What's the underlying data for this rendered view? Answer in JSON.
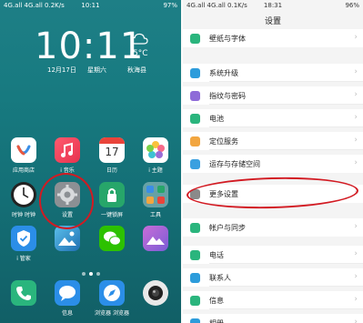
{
  "home": {
    "status": {
      "left": "4G.all 4G.all 0.2K/s",
      "time": "10:11",
      "right": "97%"
    },
    "clock": "10:11",
    "date": "12月17日",
    "weekday": "星期六",
    "temperature": "5°C",
    "city": "秋海县",
    "apps": [
      {
        "label": "应用商店"
      },
      {
        "label": "i 音乐"
      },
      {
        "label": "日历"
      },
      {
        "label": "i 主题"
      },
      {
        "label": "时钟 时钟"
      },
      {
        "label": "设置"
      },
      {
        "label": "一键锁屏"
      },
      {
        "label": "工具"
      },
      {
        "label": "i 管家"
      },
      {
        "label": ""
      },
      {
        "label": ""
      },
      {
        "label": ""
      }
    ],
    "calendar_day": "17",
    "dock": [
      {
        "label": ""
      },
      {
        "label": "信息"
      },
      {
        "label": "浏览器 浏览器"
      },
      {
        "label": ""
      }
    ]
  },
  "settings": {
    "status": {
      "left": "4G.all 4G.all 0.1K/s",
      "time": "18:31",
      "right": "96%"
    },
    "title": "设置",
    "rows": [
      {
        "label": "壁纸与字体",
        "color": "#2ab57d"
      },
      {
        "label": "系统升级",
        "color": "#2d9cdb"
      },
      {
        "label": "指纹与密码",
        "color": "#8e6bd8"
      },
      {
        "label": "电池",
        "color": "#2ab57d"
      },
      {
        "label": "定位服务",
        "color": "#f2a640"
      },
      {
        "label": "运存与存储空间",
        "color": "#3aa0e0"
      },
      {
        "label": "更多设置",
        "color": "#8a8a8a"
      },
      {
        "label": "帐户与同步",
        "color": "#2ab57d"
      },
      {
        "label": "电话",
        "color": "#2ab57d"
      },
      {
        "label": "联系人",
        "color": "#2d9cdb"
      },
      {
        "label": "信息",
        "color": "#2ab57d"
      },
      {
        "label": "相册",
        "color": "#2d9cdb"
      }
    ]
  },
  "accents": {
    "annotation_red": "#d21a22",
    "teal": "#177a80"
  }
}
